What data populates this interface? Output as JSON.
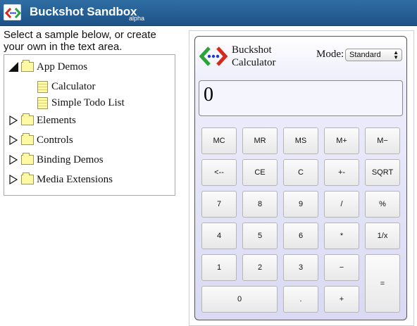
{
  "header": {
    "title": "Buckshot Sandbox",
    "badge": "alpha"
  },
  "sidebar": {
    "instructions": "Select a sample below, or create your own in the text area.",
    "tree": [
      {
        "label": "App Demos",
        "expanded": true,
        "children": [
          "Calculator",
          "Simple Todo List"
        ]
      },
      {
        "label": "Elements",
        "expanded": false
      },
      {
        "label": "Controls",
        "expanded": false
      },
      {
        "label": "Binding Demos",
        "expanded": false
      },
      {
        "label": "Media Extensions",
        "expanded": false
      }
    ]
  },
  "calculator": {
    "title_line1": "Buckshot",
    "title_line2": "Calculator",
    "mode_label": "Mode:",
    "mode_value": "Standard",
    "display_value": "0",
    "keys": {
      "mc": "MC",
      "mr": "MR",
      "ms": "MS",
      "mplus": "M+",
      "mminus": "M−",
      "back": "<--",
      "ce": "CE",
      "c": "C",
      "neg": "+-",
      "sqrt": "SQRT",
      "d7": "7",
      "d8": "8",
      "d9": "9",
      "div": "/",
      "pct": "%",
      "d4": "4",
      "d5": "5",
      "d6": "6",
      "mul": "*",
      "inv": "1/x",
      "d1": "1",
      "d2": "2",
      "d3": "3",
      "sub": "−",
      "eq": "=",
      "d0": "0",
      "dot": ".",
      "add": "+"
    }
  },
  "colors": {
    "header_bg": "#1f5a90",
    "calc_bg_bottom": "#d9d9f3",
    "logo_red": "#d42a1d",
    "logo_green": "#2aa33a",
    "logo_blue": "#1f3bd1"
  }
}
